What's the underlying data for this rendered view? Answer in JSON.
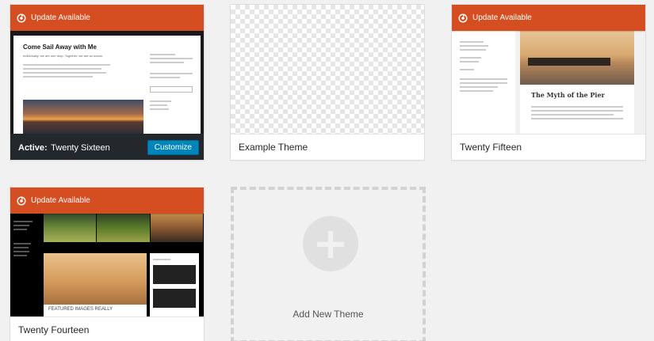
{
  "themes": [
    {
      "name": "Twenty Sixteen",
      "status_label": "Active:",
      "update_label": "Update Available",
      "action_label": "Customize",
      "preview": {
        "title": "Come Sail Away with Me",
        "subtitle": "Individually, we are one drop. Together, we are an ocean."
      }
    },
    {
      "name": "Example Theme"
    },
    {
      "name": "Twenty Fifteen",
      "update_label": "Update Available",
      "preview": {
        "title": "The Myth of the Pier"
      }
    },
    {
      "name": "Twenty Fourteen",
      "update_label": "Update Available",
      "preview": {
        "caption": "FEATURED IMAGES REALLY"
      }
    }
  ],
  "add_new": {
    "label": "Add New Theme"
  },
  "colors": {
    "update_banner": "#d54e21",
    "active_bar": "#23282d",
    "primary_button": "#0085ba"
  }
}
